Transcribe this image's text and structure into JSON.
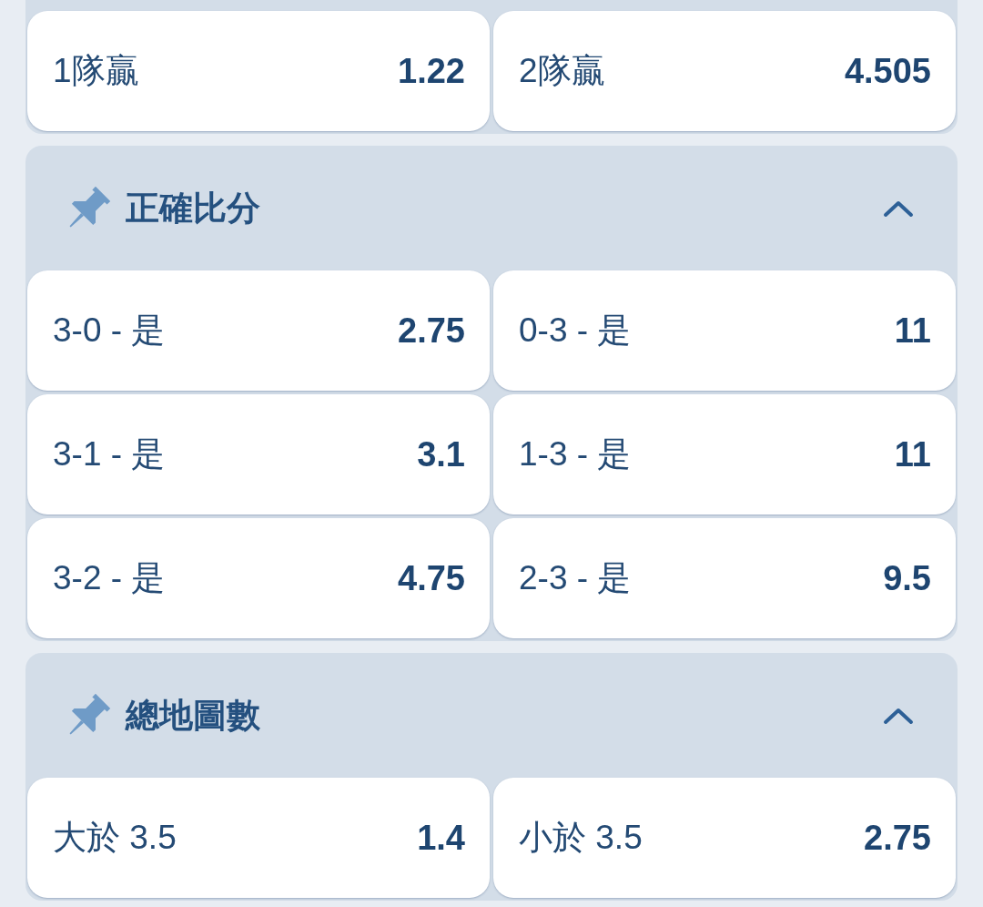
{
  "markets": [
    {
      "outcomes": [
        {
          "label": "1隊贏",
          "odds": "1.22"
        },
        {
          "label": "2隊贏",
          "odds": "4.505"
        }
      ]
    },
    {
      "title": "正確比分",
      "pinned": true,
      "expanded": true,
      "outcomes": [
        {
          "label": "3-0 - 是",
          "odds": "2.75"
        },
        {
          "label": "0-3 - 是",
          "odds": "11"
        },
        {
          "label": "3-1 - 是",
          "odds": "3.1"
        },
        {
          "label": "1-3 - 是",
          "odds": "11"
        },
        {
          "label": "3-2 - 是",
          "odds": "4.75"
        },
        {
          "label": "2-3 - 是",
          "odds": "9.5"
        }
      ]
    },
    {
      "title": "總地圖數",
      "pinned": true,
      "expanded": true,
      "outcomes": [
        {
          "label": "大於 3.5",
          "odds": "1.4"
        },
        {
          "label": "小於 3.5",
          "odds": "2.75"
        }
      ]
    }
  ]
}
